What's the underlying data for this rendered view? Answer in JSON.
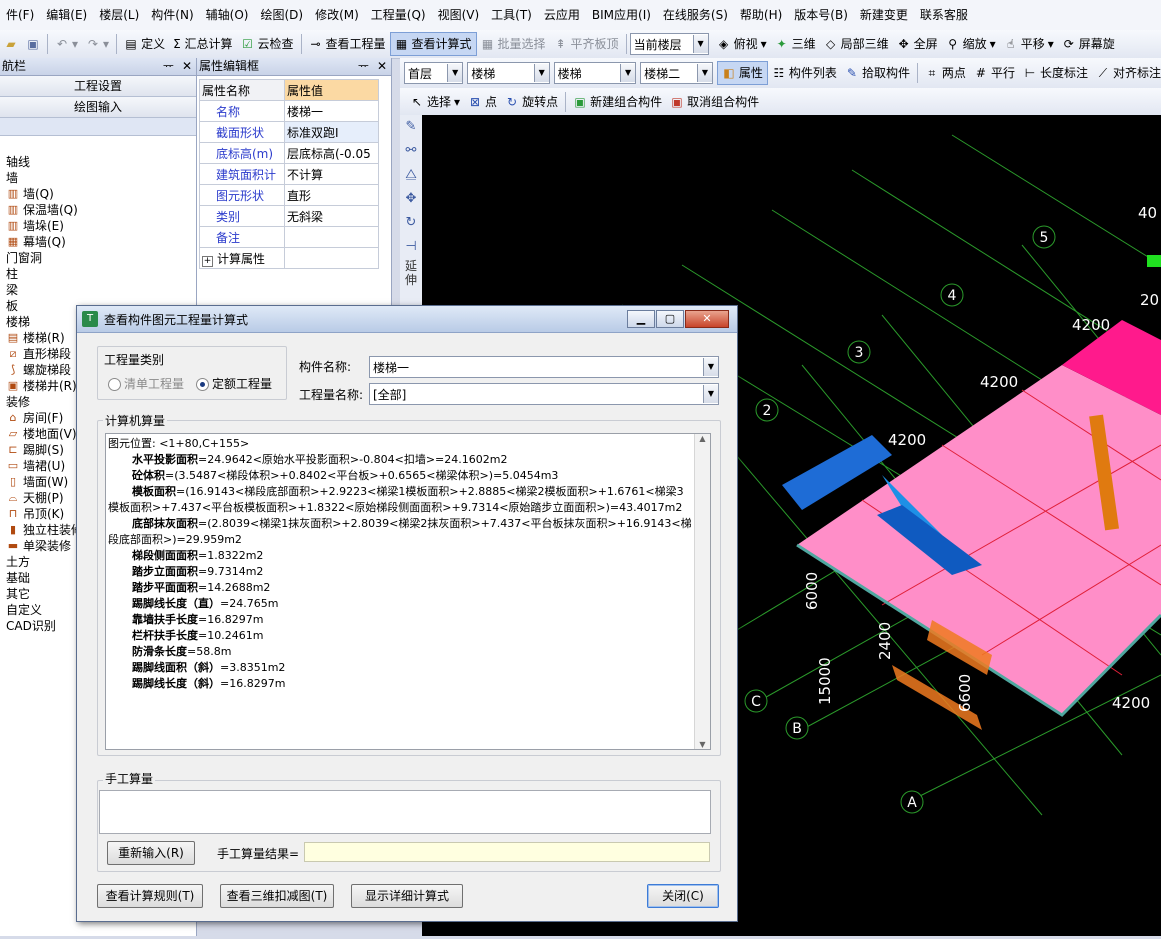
{
  "menu": [
    "件(F)",
    "编辑(E)",
    "楼层(L)",
    "构件(N)",
    "辅轴(O)",
    "绘图(D)",
    "修改(M)",
    "工程量(Q)",
    "视图(V)",
    "工具(T)",
    "云应用",
    "BIM应用(I)",
    "在线服务(S)",
    "帮助(H)",
    "版本号(B)",
    "新建变更",
    "联系客服"
  ],
  "toolbar": {
    "items": [
      "定义",
      "Σ 汇总计算",
      "云检查",
      "查看工程量",
      "查看计算式",
      "批量选择",
      "平齐板顶"
    ],
    "floor_label": "当前楼层",
    "view_items": [
      "俯视",
      "三维",
      "局部三维",
      "全屏",
      "缩放",
      "平移",
      "屏幕旋"
    ]
  },
  "nav": {
    "title": "航栏",
    "btn1": "工程设置",
    "btn2": "绘图输入",
    "tree": [
      {
        "lv": 0,
        "label": "轴线"
      },
      {
        "lv": 0,
        "label": "墙"
      },
      {
        "lv": 1,
        "label": "墙(Q)"
      },
      {
        "lv": 1,
        "label": "保温墙(Q)"
      },
      {
        "lv": 1,
        "label": "墙垛(E)"
      },
      {
        "lv": 1,
        "label": "幕墙(Q)"
      },
      {
        "lv": 0,
        "label": "门窗洞"
      },
      {
        "lv": 0,
        "label": "柱"
      },
      {
        "lv": 0,
        "label": "梁"
      },
      {
        "lv": 0,
        "label": "板"
      },
      {
        "lv": 0,
        "label": "楼梯"
      },
      {
        "lv": 1,
        "label": "楼梯(R)"
      },
      {
        "lv": 1,
        "label": "直形梯段"
      },
      {
        "lv": 1,
        "label": "螺旋梯段"
      },
      {
        "lv": 1,
        "label": "楼梯井(R)"
      },
      {
        "lv": 0,
        "label": "装修"
      },
      {
        "lv": 1,
        "label": "房间(F)"
      },
      {
        "lv": 1,
        "label": "楼地面(V)"
      },
      {
        "lv": 1,
        "label": "踢脚(S)"
      },
      {
        "lv": 1,
        "label": "墙裙(U)"
      },
      {
        "lv": 1,
        "label": "墙面(W)"
      },
      {
        "lv": 1,
        "label": "天棚(P)"
      },
      {
        "lv": 1,
        "label": "吊顶(K)"
      },
      {
        "lv": 1,
        "label": "独立柱装修"
      },
      {
        "lv": 1,
        "label": "单梁装修"
      },
      {
        "lv": 0,
        "label": "土方"
      },
      {
        "lv": 0,
        "label": "基础"
      },
      {
        "lv": 0,
        "label": "其它"
      },
      {
        "lv": 0,
        "label": "自定义"
      },
      {
        "lv": 0,
        "label": "CAD识别"
      }
    ]
  },
  "props": {
    "title": "属性编辑框",
    "col1": "属性名称",
    "col2": "属性值",
    "rows": [
      {
        "k": "名称",
        "v": "楼梯一"
      },
      {
        "k": "截面形状",
        "v": "标准双跑I"
      },
      {
        "k": "底标高(m)",
        "v": "层底标高(-0.05"
      },
      {
        "k": "建筑面积计",
        "v": "不计算"
      },
      {
        "k": "图元形状",
        "v": "直形"
      },
      {
        "k": "类别",
        "v": "无斜梁"
      },
      {
        "k": "备注",
        "v": ""
      }
    ],
    "expand": "计算属性"
  },
  "rightbar": {
    "combos": [
      "首层",
      "楼梯",
      "楼梯",
      "楼梯二"
    ],
    "items": [
      "属性",
      "构件列表",
      "拾取构件",
      "两点",
      "平行",
      "长度标注",
      "对齐标注"
    ],
    "row2": [
      "选择",
      "点",
      "旋转点",
      "新建组合构件",
      "取消组合构件"
    ]
  },
  "vtool": [
    "延",
    "伸"
  ],
  "canvas": {
    "dims": [
      "40",
      "20",
      "4200",
      "4200",
      "4200",
      "6000",
      "2400",
      "15000",
      "6600",
      "4200"
    ],
    "axes": [
      "5",
      "4",
      "3",
      "2",
      "C",
      "B",
      "A"
    ]
  },
  "dialog": {
    "title": "查看构件图元工程量计算式",
    "qty_type_label": "工程量类别",
    "opt1": "清单工程量",
    "opt2": "定额工程量",
    "comp_label": "构件名称:",
    "comp_value": "楼梯一",
    "qty_name_label": "工程量名称:",
    "qty_name_value": "[全部]",
    "calc_label": "计算机算量",
    "lines": [
      {
        "t": "plain",
        "text": "图元位置: <1+80,C+155>"
      },
      {
        "t": "item",
        "k": "水平投影面积",
        "v": "=24.9642<原始水平投影面积>-0.804<扣墙>=24.1602m2"
      },
      {
        "t": "item",
        "k": "砼体积",
        "v": "=(3.5487<梯段体积>+0.8402<平台板>+0.6565<梯梁体积>)=5.0454m3"
      },
      {
        "t": "wrap",
        "k": "模板面积",
        "v": "=(16.9143<梯段底部面积>+2.9223<梯梁1模板面积>+2.8885<梯梁2模板面积>+1.6761<梯梁3模板面积>+7.437<平台板模板面积>+1.8322<原始梯段侧面面积>+9.7314<原始踏步立面面积>)=43.4017m2"
      },
      {
        "t": "wrap",
        "k": "底部抹灰面积",
        "v": "=(2.8039<梯梁1抹灰面积>+2.8039<梯梁2抹灰面积>+7.437<平台板抹灰面积>+16.9143<梯段底部面积>)=29.959m2"
      },
      {
        "t": "item",
        "k": "梯段侧面面积",
        "v": "=1.8322m2"
      },
      {
        "t": "item",
        "k": "踏步立面面积",
        "v": "=9.7314m2"
      },
      {
        "t": "item",
        "k": "踏步平面面积",
        "v": "=14.2688m2"
      },
      {
        "t": "item",
        "k": "踢脚线长度（直）",
        "v": "=24.765m"
      },
      {
        "t": "item",
        "k": "靠墙扶手长度",
        "v": "=16.8297m"
      },
      {
        "t": "item",
        "k": "栏杆扶手长度",
        "v": "=10.2461m"
      },
      {
        "t": "item",
        "k": "防滑条长度",
        "v": "=58.8m"
      },
      {
        "t": "item",
        "k": "踢脚线面积（斜）",
        "v": "=3.8351m2"
      },
      {
        "t": "item",
        "k": "踢脚线长度（斜）",
        "v": "=16.8297m"
      }
    ],
    "manual_label": "手工算量",
    "reinput": "重新输入(R)",
    "manual_result_label": "手工算量结果=",
    "btn_rules": "查看计算规则(T)",
    "btn_3d": "查看三维扣减图(T)",
    "btn_detail": "显示详细计算式",
    "btn_close": "关闭(C)"
  }
}
